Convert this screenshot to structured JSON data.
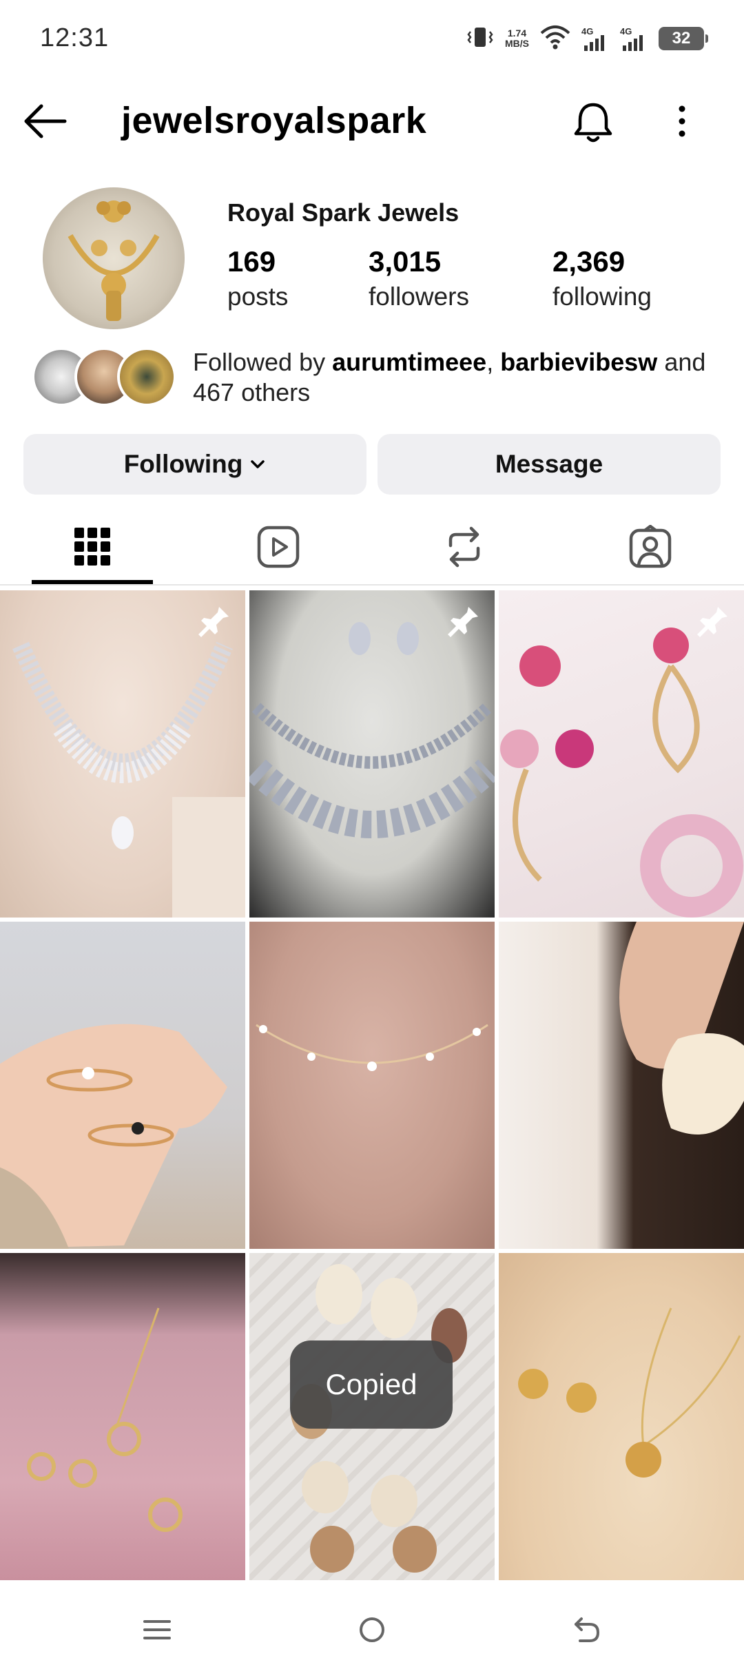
{
  "status_bar": {
    "time": "12:31",
    "net_speed_value": "1.74",
    "net_speed_unit": "MB/S",
    "sim1": "4G",
    "sim2": "4G",
    "battery": "32"
  },
  "header": {
    "username": "jewelsroyalspark"
  },
  "profile": {
    "display_name": "Royal Spark Jewels",
    "posts_count": "169",
    "posts_label": "posts",
    "followers_count": "3,015",
    "followers_label": "followers",
    "following_count": "2,369",
    "following_label": "following"
  },
  "followed_by": {
    "prefix": "Followed by ",
    "user1": "aurumtimeee",
    "separator": ", ",
    "user2": "barbievibesw",
    "and_text": " and ",
    "others_count": "467",
    "others_suffix": " others"
  },
  "actions": {
    "following_label": "Following",
    "message_label": "Message"
  },
  "tabs": [
    "posts-grid",
    "reels",
    "reposts",
    "tagged"
  ],
  "active_tab": "posts-grid",
  "posts": [
    {
      "subject": "diamond necklace on bust",
      "pinned": true
    },
    {
      "subject": "crystal necklace and drop earrings",
      "pinned": true
    },
    {
      "subject": "pink rose earrings",
      "pinned": true
    },
    {
      "subject": "flower rings on hand",
      "pinned": false
    },
    {
      "subject": "pearl choker necklace",
      "pinned": false
    },
    {
      "subject": "large cream earring",
      "pinned": false
    },
    {
      "subject": "gold circle jewelry set",
      "pinned": false
    },
    {
      "subject": "shell earrings",
      "pinned": false
    },
    {
      "subject": "gold rose earrings and pendant",
      "pinned": false
    }
  ],
  "toast": {
    "text": "Copied"
  },
  "colors": {
    "button_bg": "#efeff2",
    "toast_bg": "#464646",
    "tab_indicator": "#000000"
  }
}
